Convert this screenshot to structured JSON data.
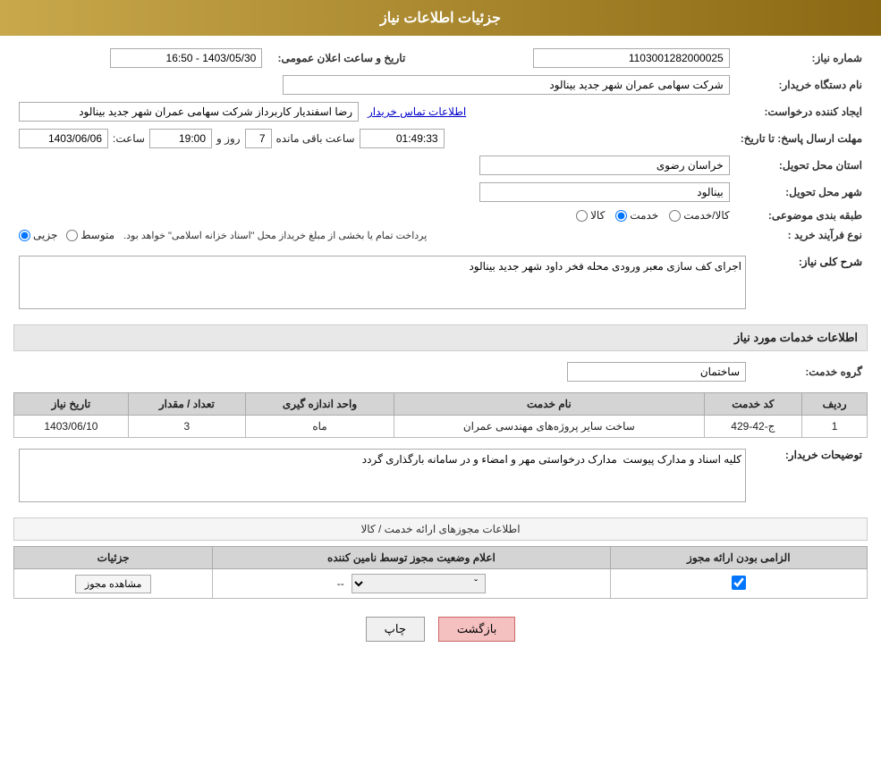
{
  "header": {
    "title": "جزئیات اطلاعات نیاز"
  },
  "form": {
    "need_number_label": "شماره نیاز:",
    "need_number_value": "1103001282000025",
    "buyer_org_label": "نام دستگاه خریدار:",
    "buyer_org_value": "شرکت سهامی عمران شهر جدید بینالود",
    "creator_label": "ایجاد کننده درخواست:",
    "creator_value": "رضا اسفندیار کاربرداز شرکت سهامی عمران شهر جدید بینالود",
    "creator_link": "اطلاعات تماس خریدار",
    "deadline_label": "مهلت ارسال پاسخ: تا تاریخ:",
    "deadline_date": "1403/06/06",
    "deadline_time_label": "ساعت:",
    "deadline_time": "19:00",
    "deadline_days_label": "روز و",
    "deadline_days": "7",
    "deadline_remain_label": "ساعت باقی مانده",
    "deadline_remain": "01:49:33",
    "announce_label": "تاریخ و ساعت اعلان عمومی:",
    "announce_value": "1403/05/30 - 16:50",
    "province_label": "استان محل تحویل:",
    "province_value": "خراسان رضوی",
    "city_label": "شهر محل تحویل:",
    "city_value": "بینالود",
    "category_label": "طبقه بندی موضوعی:",
    "category_kala": "کالا",
    "category_khadamat": "خدمت",
    "category_kala_khadamat": "کالا/خدمت",
    "purchase_type_label": "نوع فرآیند خرید :",
    "purchase_type_jozii": "جزیی",
    "purchase_type_mootaset": "متوسط",
    "purchase_type_note": "پرداخت تمام یا بخشی از مبلغ خریداز محل \"اسناد خزانه اسلامی\" خواهد بود.",
    "description_label": "شرح کلی نیاز:",
    "description_value": "اجرای کف سازی معبر ورودی محله فخر داود شهر جدید بینالود",
    "services_section": "اطلاعات خدمات مورد نیاز",
    "service_group_label": "گروه خدمت:",
    "service_group_value": "ساختمان",
    "table": {
      "col_row": "ردیف",
      "col_code": "کد خدمت",
      "col_name": "نام خدمت",
      "col_unit": "واحد اندازه گیری",
      "col_quantity": "تعداد / مقدار",
      "col_date": "تاریخ نیاز",
      "rows": [
        {
          "row": "1",
          "code": "ج-42-429",
          "name": "ساخت سایر پروژه‌های مهندسی عمران",
          "unit": "ماه",
          "quantity": "3",
          "date": "1403/06/10"
        }
      ]
    },
    "buyer_notes_label": "توضیحات خریدار:",
    "buyer_notes_value": "کلیه اسناد و مدارک پیوست  مدارک درخواستی مهر و امضاء و در سامانه بارگذاری گردد",
    "licenses_section": "اطلاعات مجوزهای ارائه خدمت / کالا",
    "perm_table": {
      "col_mandatory": "الزامی بودن ارائه مجوز",
      "col_notify": "اعلام وضعیت مجوز توسط نامین کننده",
      "col_details": "جزئیات",
      "rows": [
        {
          "mandatory": true,
          "notify_value": "--",
          "details_label": "مشاهده مجوز"
        }
      ]
    },
    "btn_print": "چاپ",
    "btn_back": "بازگشت"
  }
}
